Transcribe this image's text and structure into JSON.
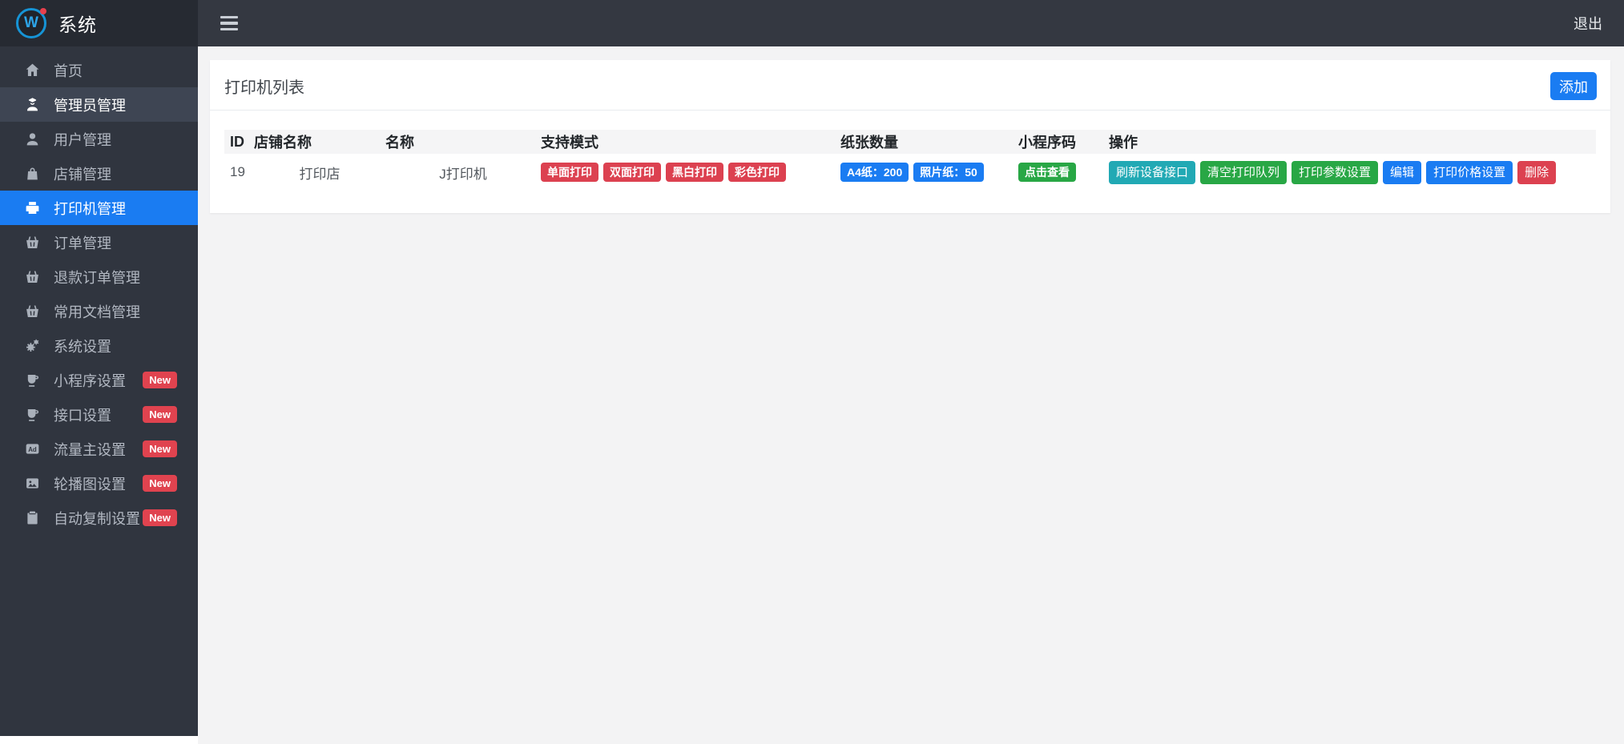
{
  "app": {
    "logo_letter": "W",
    "title": "系统",
    "logout_label": "退出"
  },
  "sidebar": {
    "items": [
      {
        "label": "首页",
        "icon": "home"
      },
      {
        "label": "管理员管理",
        "icon": "admin",
        "highlight": true
      },
      {
        "label": "用户管理",
        "icon": "user"
      },
      {
        "label": "店铺管理",
        "icon": "bag"
      },
      {
        "label": "打印机管理",
        "icon": "printer",
        "active": true
      },
      {
        "label": "订单管理",
        "icon": "basket"
      },
      {
        "label": "退款订单管理",
        "icon": "basket"
      },
      {
        "label": "常用文档管理",
        "icon": "basket"
      },
      {
        "label": "系统设置",
        "icon": "gears"
      },
      {
        "label": "小程序设置",
        "icon": "cup",
        "badge": "New"
      },
      {
        "label": "接口设置",
        "icon": "cup",
        "badge": "New"
      },
      {
        "label": "流量主设置",
        "icon": "ad",
        "badge": "New"
      },
      {
        "label": "轮播图设置",
        "icon": "image",
        "badge": "New"
      },
      {
        "label": "自动复制设置",
        "icon": "clipboard",
        "badge": "New"
      }
    ]
  },
  "page": {
    "card_title": "打印机列表",
    "add_button_label": "添加"
  },
  "table": {
    "columns": [
      "ID",
      "店铺名称",
      "名称",
      "支持模式",
      "纸张数量",
      "小程序码",
      "操作"
    ],
    "rows": [
      {
        "id": "19",
        "shop_name": "打印店",
        "name": "J打印机",
        "modes": [
          "单面打印",
          "双面打印",
          "黑白打印",
          "彩色打印"
        ],
        "paper": [
          "A4纸：200",
          "照片纸：50"
        ],
        "qr_label": "点击查看",
        "operations": [
          {
            "label": "刷新设备接口",
            "color": "teal"
          },
          {
            "label": "清空打印队列",
            "color": "green"
          },
          {
            "label": "打印参数设置",
            "color": "green"
          },
          {
            "label": "编辑",
            "color": "blue"
          },
          {
            "label": "打印价格设置",
            "color": "blue"
          },
          {
            "label": "删除",
            "color": "red"
          }
        ]
      }
    ]
  },
  "colors": {
    "accent_blue": "#1a7cf2",
    "badge_red": "#dc4150",
    "badge_blue": "#1a7cf2",
    "badge_green": "#28a745",
    "badge_teal": "#21a9b4",
    "new_badge_red": "#e0434f"
  }
}
